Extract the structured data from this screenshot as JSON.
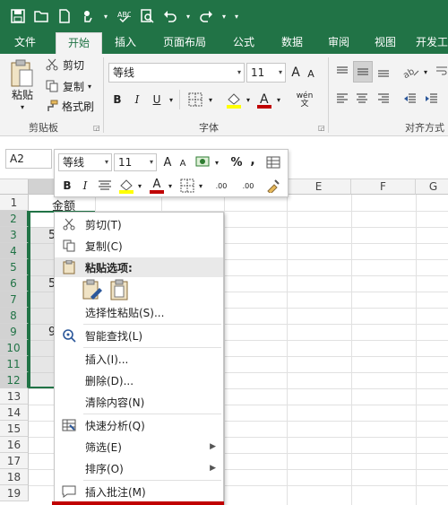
{
  "qat": {
    "icons": [
      "save-icon",
      "open-folder-icon",
      "new-file-icon",
      "touch-mode-icon",
      "spelling-icon",
      "print-preview-icon",
      "undo-icon",
      "redo-icon",
      "customize-qat-icon"
    ]
  },
  "tabs": [
    "文件",
    "开始",
    "插入",
    "页面布局",
    "公式",
    "数据",
    "审阅",
    "视图",
    "开发工"
  ],
  "active_tab": "开始",
  "ribbon": {
    "clipboard": {
      "paste": "粘贴",
      "cut": "剪切",
      "copy": "复制",
      "format_painter": "格式刷",
      "group_label": "剪贴板"
    },
    "font": {
      "font_name": "等线",
      "font_size": "11",
      "bold": "B",
      "italic": "I",
      "underline": "U",
      "increase_size": "A",
      "decrease_size": "A",
      "phonetic": "wén",
      "group_label": "字体"
    },
    "alignment": {
      "group_label": "对齐方式"
    }
  },
  "formula_bar": {
    "name_box": "A2"
  },
  "grid": {
    "columns": [
      "E",
      "F",
      "G"
    ],
    "rows": [
      "1",
      "2",
      "3",
      "4",
      "5",
      "6",
      "7",
      "8",
      "9",
      "10",
      "11",
      "12",
      "13",
      "14",
      "15",
      "16",
      "17",
      "18",
      "19"
    ],
    "a1_text": "金额",
    "partial_cells": [
      "5",
      "5",
      "9"
    ]
  },
  "mini_toolbar": {
    "font_name": "等线",
    "font_size": "11",
    "inc": "A",
    "dec": "A",
    "percent": "%",
    "comma": ",",
    "bold": "B",
    "italic": "I",
    "font_color": "A",
    "inc_decimal": ".00",
    "dec_decimal": ".00"
  },
  "context_menu": {
    "cut": "剪切(T)",
    "copy": "复制(C)",
    "paste_options": "粘贴选项:",
    "paste_special": "选择性粘贴(S)...",
    "smart_lookup": "智能查找(L)",
    "insert": "插入(I)...",
    "delete": "删除(D)...",
    "clear_contents": "清除内容(N)",
    "quick_analysis": "快速分析(Q)",
    "filter": "筛选(E)",
    "sort": "排序(O)",
    "insert_comment": "插入批注(M)"
  },
  "colors": {
    "excel_green": "#217346",
    "highlight_red": "#c00000"
  }
}
